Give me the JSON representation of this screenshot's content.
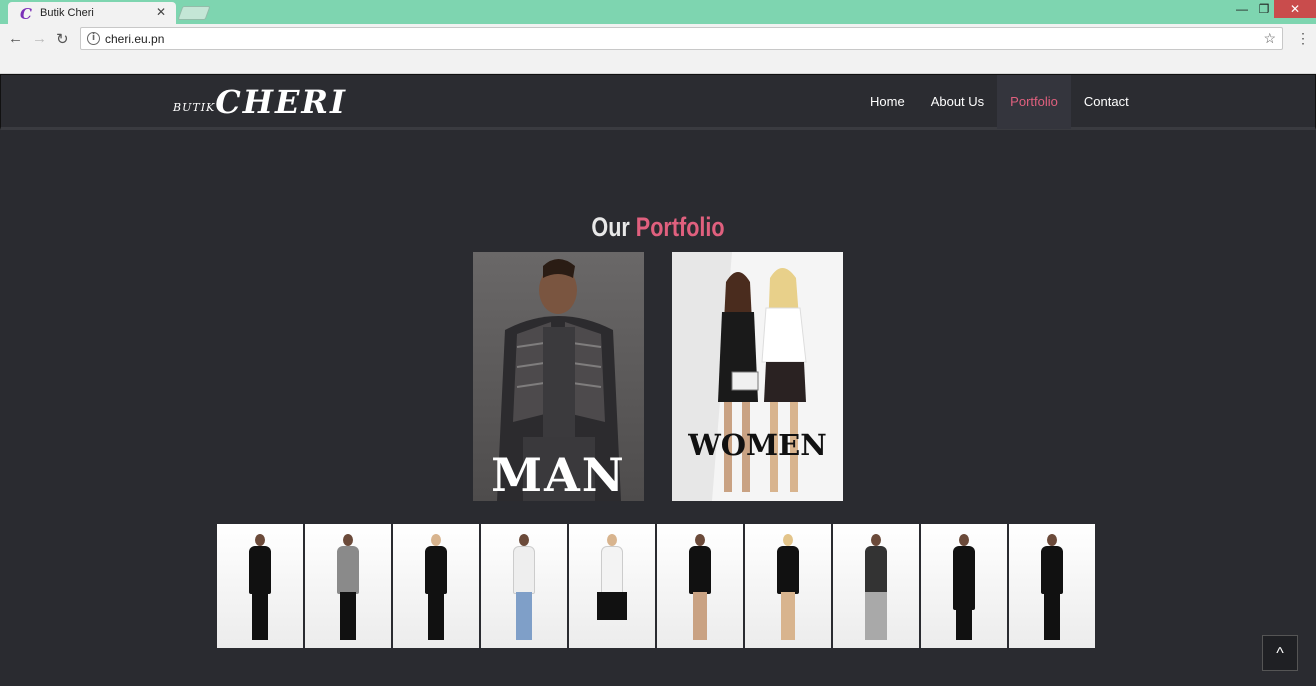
{
  "browser": {
    "tab_title": "Butik Cheri",
    "tab_close": "✕",
    "url": "cheri.eu.pn",
    "window_controls": {
      "minimize": "—",
      "maximize": "❐",
      "close": "✕"
    },
    "icons": {
      "back": "←",
      "forward": "→",
      "reload": "↻",
      "info": "i",
      "star": "☆",
      "menu": "⋮",
      "favicon": "C"
    }
  },
  "site": {
    "logo": {
      "small": "BUTIK",
      "big": "CHERI"
    },
    "nav": [
      {
        "label": "Home",
        "active": false
      },
      {
        "label": "About Us",
        "active": false
      },
      {
        "label": "Portfolio",
        "active": true
      },
      {
        "label": "Contact",
        "active": false
      }
    ],
    "accent_color": "#e0607e"
  },
  "portfolio": {
    "title_plain": "Our",
    "title_accent": "Portfolio",
    "categories": [
      {
        "label": "MAN"
      },
      {
        "label": "WOMEN"
      }
    ],
    "thumbnail_count": 10
  },
  "scroll_top_icon": "^"
}
